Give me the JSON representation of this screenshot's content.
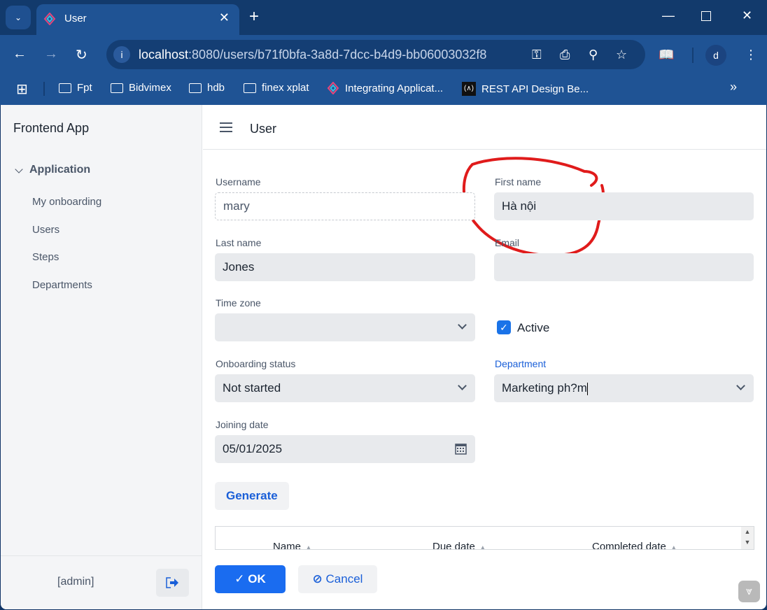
{
  "browser": {
    "tab_title": "User",
    "new_tab": "+",
    "url_host": "localhost",
    "url_rest": ":8080/users/b71f0bfa-3a8d-7dcc-b4d9-bb06003032f8",
    "profile": "d",
    "bookmarks": [
      {
        "label": "Fpt"
      },
      {
        "label": "Bidvimex"
      },
      {
        "label": "hdb"
      },
      {
        "label": "finex xplat"
      },
      {
        "label": "Integrating Applicat..."
      },
      {
        "label": "REST API Design Be..."
      }
    ],
    "more": "»"
  },
  "sidebar": {
    "app_name": "Frontend App",
    "group": "Application",
    "items": [
      {
        "label": "My onboarding"
      },
      {
        "label": "Users"
      },
      {
        "label": "Steps"
      },
      {
        "label": "Departments"
      }
    ],
    "user": "[admin]"
  },
  "header": {
    "title": "User"
  },
  "form": {
    "username": {
      "label": "Username",
      "value": "mary"
    },
    "first_name": {
      "label": "First name",
      "value": "Hà nội"
    },
    "last_name": {
      "label": "Last name",
      "value": "Jones"
    },
    "email": {
      "label": "Email",
      "value": ""
    },
    "time_zone": {
      "label": "Time zone",
      "value": ""
    },
    "active": {
      "label": "Active",
      "checked": true
    },
    "onboarding_status": {
      "label": "Onboarding status",
      "value": "Not started"
    },
    "department": {
      "label": "Department",
      "value": "Marketing ph?m"
    },
    "joining_date": {
      "label": "Joining date",
      "value": "05/01/2025"
    }
  },
  "generate_label": "Generate",
  "grid": {
    "columns": [
      {
        "label": "Name"
      },
      {
        "label": "Due date"
      },
      {
        "label": "Completed date"
      }
    ]
  },
  "actions": {
    "ok": "OK",
    "cancel": "Cancel"
  },
  "colors": {
    "accent": "#1a6cf0",
    "annotation": "#e01b1b",
    "focused_label": "#1a5fd8"
  }
}
